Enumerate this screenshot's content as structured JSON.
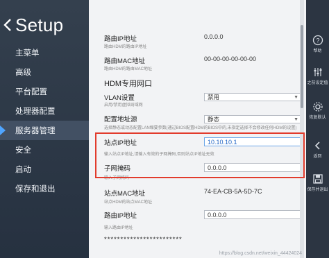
{
  "header": {
    "title": "Setup"
  },
  "sidebar": {
    "items": [
      {
        "label": "主菜单"
      },
      {
        "label": "高级"
      },
      {
        "label": "平台配置"
      },
      {
        "label": "处理器配置"
      },
      {
        "label": "服务器管理",
        "active": true
      },
      {
        "label": "安全"
      },
      {
        "label": "启动"
      },
      {
        "label": "保存和退出"
      }
    ]
  },
  "content": {
    "router_ip": {
      "label": "路由IP地址",
      "hint": "路由HDM的路由IP地址",
      "value": "0.0.0.0"
    },
    "router_mac": {
      "label": "路由MAC地址",
      "hint": "路由HDM的路由MAC地址",
      "value": "00-00-00-00-00-00"
    },
    "section_title": "HDM专用网口",
    "vlan": {
      "label": "VLAN设置",
      "hint": "启用/禁用虚拟局域网",
      "value": "禁用"
    },
    "addr_source": {
      "label": "配置地址源",
      "hint": "选择静态或动态配置LAN缩要参数(通过BIOS配置HDM的BIOS中的,未指定选择不会修改任何HDM的设置)",
      "value": "静态"
    },
    "station_ip": {
      "label": "站点IP地址",
      "hint": "输入站点IP地址,请输入有效的子网掩码,否则站点IP地址无效",
      "value": "10.10.10.1"
    },
    "subnet": {
      "label": "子网掩码",
      "hint": "输入子网掩码",
      "value": "0.0.0.0"
    },
    "station_mac": {
      "label": "站点MAC地址",
      "hint": "站点HDM的站点MAC地址",
      "value": "74-EA-CB-5A-5D-7C"
    },
    "router_ip2": {
      "label": "路由IP地址",
      "hint": "输入路由IP地址",
      "value": "0.0.0.0"
    },
    "stars": "************************",
    "watermark": "https://blog.csdn.net/weixin_44424024"
  },
  "toolbar": {
    "items": [
      {
        "label": "帮助",
        "icon": "help-icon"
      },
      {
        "label": "之前设定值",
        "icon": "sliders-icon"
      },
      {
        "label": "恢复默认",
        "icon": "gear-icon"
      },
      {
        "label": "返回",
        "icon": "return-icon"
      },
      {
        "label": "保存并退出",
        "icon": "save-icon"
      }
    ]
  },
  "colors": {
    "accent": "#4fa5ff",
    "highlight": "#e23b2c",
    "panel": "#f2f3f5",
    "sidebar": "#2b3440"
  }
}
